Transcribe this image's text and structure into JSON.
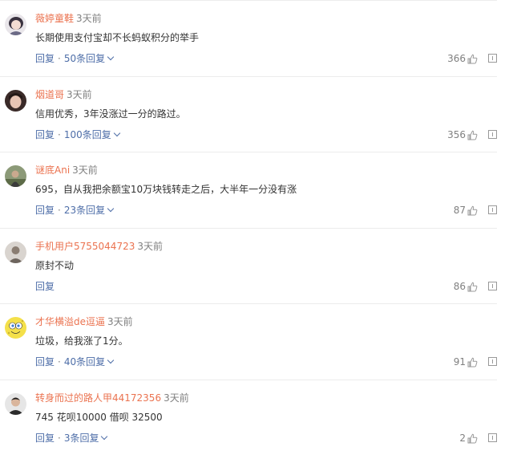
{
  "comments": [
    {
      "username": "薇婷童鞋",
      "time": "3天前",
      "content": "长期使用支付宝却不长蚂蚁积分的举手",
      "reply_label": "回复",
      "sub_replies": "50条回复",
      "likes": "366",
      "avatar": "girl-illustration-avatar"
    },
    {
      "username": "烟道哥",
      "time": "3天前",
      "content": "信用优秀，3年没涨过一分的路过。",
      "reply_label": "回复",
      "sub_replies": "100条回复",
      "likes": "356",
      "avatar": "girl-photo-avatar"
    },
    {
      "username": "谜底Ani",
      "time": "3天前",
      "content": "695，自从我把余额宝10万块钱转走之后，大半年一分没有涨",
      "reply_label": "回复",
      "sub_replies": "23条回复",
      "likes": "87",
      "avatar": "outdoor-photo-avatar"
    },
    {
      "username": "手机用户5755044723",
      "time": "3天前",
      "content": "原封不动",
      "reply_label": "回复",
      "sub_replies": "",
      "likes": "86",
      "avatar": "default-user-avatar"
    },
    {
      "username": "才华横溢de逗逼",
      "time": "3天前",
      "content": "垃圾，给我涨了1分。",
      "reply_label": "回复",
      "sub_replies": "40条回复",
      "likes": "91",
      "avatar": "spongebob-avatar"
    },
    {
      "username": "转身而过的路人甲44172356",
      "time": "3天前",
      "content": "745 花呗10000 借呗 32500",
      "reply_label": "回复",
      "sub_replies": "3条回复",
      "likes": "2",
      "avatar": "man-photo-avatar"
    }
  ],
  "separator": "·",
  "colors": {
    "username": "#eb7350",
    "link": "#4e6ea8",
    "muted": "#808080",
    "text": "#333333",
    "divider": "#ececec"
  }
}
